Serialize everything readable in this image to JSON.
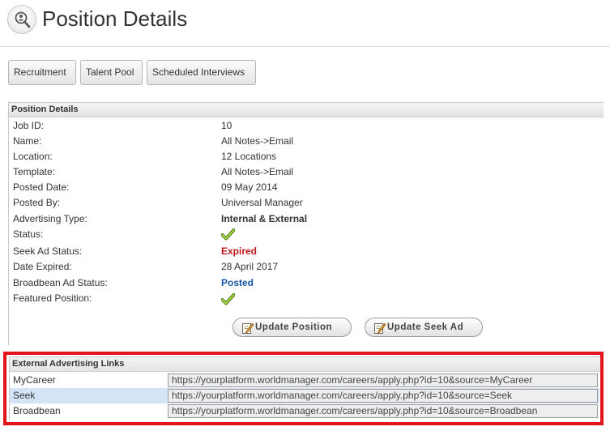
{
  "header": {
    "title": "Position Details",
    "logo_icon": "magnifier-person-icon"
  },
  "tabs": [
    {
      "label": "Recruitment"
    },
    {
      "label": "Talent Pool"
    },
    {
      "label": "Scheduled Interviews"
    }
  ],
  "details": {
    "heading": "Position Details",
    "fields": [
      {
        "label": "Job ID:",
        "value": "10"
      },
      {
        "label": "Name:",
        "value": "All Notes->Email"
      },
      {
        "label": "Location:",
        "value": "12 Locations"
      },
      {
        "label": "Template:",
        "value": "All Notes->Email"
      },
      {
        "label": "Posted Date:",
        "value": "09 May 2014"
      },
      {
        "label": "Posted By:",
        "value": "Universal Manager"
      },
      {
        "label": "Advertising Type:",
        "value": "Internal & External"
      },
      {
        "label": "Status:",
        "value": ""
      },
      {
        "label": "Seek Ad Status:",
        "value": "Expired"
      },
      {
        "label": "Date Expired:",
        "value": "28 April 2017"
      },
      {
        "label": "Broadbean Ad Status:",
        "value": "Posted"
      },
      {
        "label": "Featured Position:",
        "value": ""
      }
    ],
    "status_icon": "check-icon",
    "featured_icon": "check-icon",
    "colors": {
      "expired": "#c0181d",
      "posted": "#1a56a6",
      "check": "#7cb518"
    }
  },
  "actions": {
    "update_position": "Update Position",
    "update_seek_ad": "Update Seek Ad",
    "icon": "edit-note-icon"
  },
  "external_links": {
    "heading": "External Advertising Links",
    "links": [
      {
        "label": "MyCareer",
        "url": "https://yourplatform.worldmanager.com/careers/apply.php?id=10&source=MyCareer"
      },
      {
        "label": "Seek",
        "url": "https://yourplatform.worldmanager.com/careers/apply.php?id=10&source=Seek"
      },
      {
        "label": "Broadbean",
        "url": "https://yourplatform.worldmanager.com/careers/apply.php?id=10&source=Broadbean"
      }
    ],
    "highlight_color": "#e3141b"
  }
}
